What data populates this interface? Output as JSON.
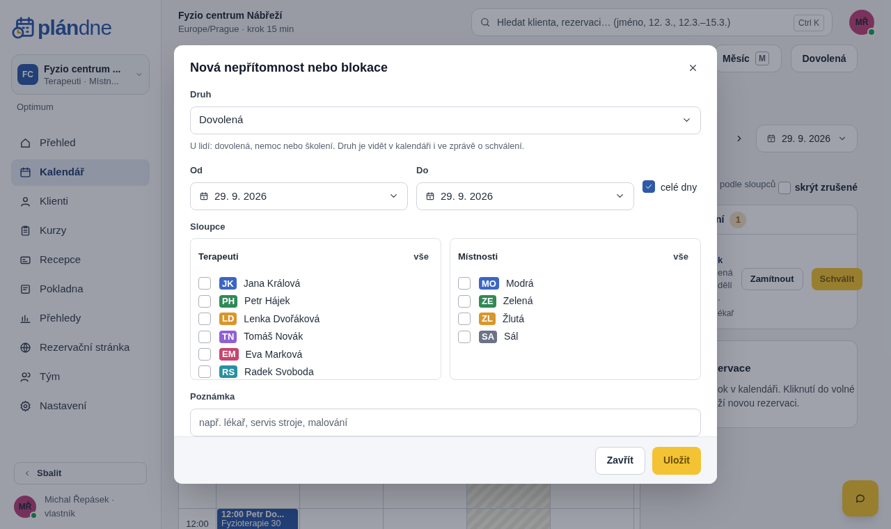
{
  "sidebar": {
    "logo": {
      "bold": "plán",
      "light": "dne"
    },
    "workspace": {
      "initials": "FC",
      "name": "Fyzio centrum ...",
      "subtitle": "Terapeuti · Místn..."
    },
    "plan": "Optimum",
    "nav": [
      {
        "label": "Přehled",
        "selected": false
      },
      {
        "label": "Kalendář",
        "selected": true
      },
      {
        "label": "Klienti",
        "selected": false
      },
      {
        "label": "Kurzy",
        "selected": false
      },
      {
        "label": "Recepce",
        "selected": false
      },
      {
        "label": "Pokladna",
        "selected": false
      },
      {
        "label": "Přehledy",
        "selected": false
      },
      {
        "label": "Rezervační stránka",
        "selected": false
      },
      {
        "label": "Tým",
        "selected": false
      },
      {
        "label": "Nastavení",
        "selected": false
      }
    ],
    "collapse": "Sbalit",
    "user": {
      "initials": "MŘ",
      "name": "Michal Řepásek · vlastník",
      "online": true
    }
  },
  "header": {
    "title": "Fyzio centrum Nábřeží",
    "subtitle": "Europe/Prague · krok 15 min",
    "search": {
      "placeholder": "Hledat klienta, rezervaci… (jméno, 12. 3., 12.3.–15.3.)",
      "shortcut": "Ctrl K"
    },
    "avatar": {
      "initials": "MŘ",
      "online": true
    }
  },
  "toolbar": {
    "month_button": {
      "label": "Měsíc",
      "shortcut": "M"
    },
    "vacation_button": "Dovolená",
    "date": "29. 9. 2026"
  },
  "filters": {
    "text": "podle sloupců",
    "hide_cancelled": {
      "label": "skrýt zrušené",
      "checked": false
    }
  },
  "requests_card": {
    "title": "ní",
    "count": "1",
    "lines": [
      "k",
      "ená",
      "dělí",
      "."
    ],
    "reject": "Zamítnout",
    "approve": "Schválit",
    "note": "ékař"
  },
  "info_card": {
    "title": "ervace",
    "lines": [
      "ok v kalendáři. Kliknutí do volné",
      "ží novou rezervaci."
    ]
  },
  "calendar": {
    "time": "12:00",
    "event": {
      "title": "12:00 Petr Do...",
      "subtitle": "Fyzioterapie 30"
    }
  },
  "modal": {
    "title": "Nová nepřítomnost nebo blokace",
    "kind": {
      "label": "Druh",
      "value": "Dovolená",
      "hint": "U lidí: dovolená, nemoc nebo školení. Druh je vidět v kalendáři i ve zprávě o schválení."
    },
    "from": {
      "label": "Od",
      "value": "29. 9. 2026"
    },
    "to": {
      "label": "Do",
      "value": "29. 9. 2026"
    },
    "all_day": {
      "label": "celé dny",
      "checked": true
    },
    "columns_label": "Sloupce",
    "groups": [
      {
        "title": "Terapeuti",
        "all": "vše",
        "items": [
          {
            "initials": "JK",
            "name": "Jana Králová",
            "color": "#3b66c4",
            "checked": false
          },
          {
            "initials": "PH",
            "name": "Petr Hájek",
            "color": "#2f8a55",
            "checked": false
          },
          {
            "initials": "LD",
            "name": "Lenka Dvořáková",
            "color": "#d9962a",
            "checked": false
          },
          {
            "initials": "TN",
            "name": "Tomáš Novák",
            "color": "#9061d3",
            "checked": false
          },
          {
            "initials": "EM",
            "name": "Eva Marková",
            "color": "#c8446e",
            "checked": false
          },
          {
            "initials": "RS",
            "name": "Radek Svoboda",
            "color": "#2b8fa3",
            "checked": false
          }
        ]
      },
      {
        "title": "Místnosti",
        "all": "vše",
        "items": [
          {
            "initials": "MO",
            "name": "Modrá",
            "color": "#3b66c4",
            "checked": false
          },
          {
            "initials": "ZE",
            "name": "Zelená",
            "color": "#2f8a55",
            "checked": false
          },
          {
            "initials": "ZL",
            "name": "Žlutá",
            "color": "#d9962a",
            "checked": false
          },
          {
            "initials": "SA",
            "name": "Sál",
            "color": "#6b7385",
            "checked": false
          }
        ]
      }
    ],
    "note": {
      "label": "Poznámka",
      "placeholder": "např. lékař, servis stroje, malování"
    },
    "buttons": {
      "close": "Zavřít",
      "save": "Uložit"
    }
  }
}
